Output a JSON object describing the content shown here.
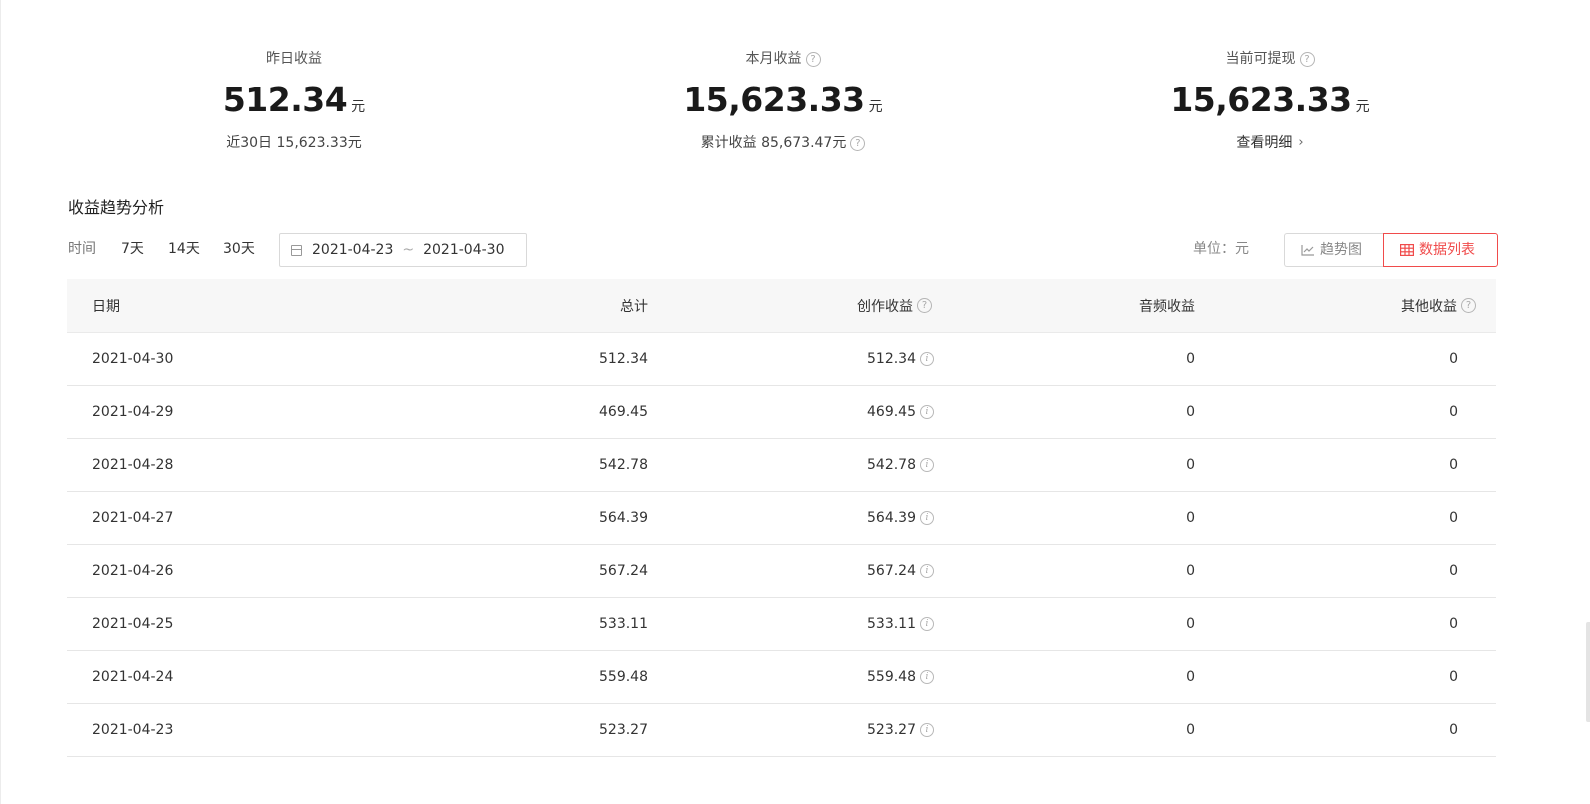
{
  "summary": {
    "yesterday": {
      "label": "昨日收益",
      "value": "512.34",
      "unit": "元",
      "sub": "近30日 15,623.33元"
    },
    "month": {
      "label": "本月收益",
      "value": "15,623.33",
      "unit": "元",
      "sub": "累计收益 85,673.47元"
    },
    "withdrawable": {
      "label": "当前可提现",
      "value": "15,623.33",
      "unit": "元",
      "link": "查看明细"
    }
  },
  "section": {
    "title": "收益趋势分析"
  },
  "toolbar": {
    "time_label": "时间",
    "ranges": [
      "7天",
      "14天",
      "30天"
    ],
    "date_start": "2021-04-23",
    "date_sep": "~",
    "date_end": "2021-04-30",
    "unit_label": "单位：元",
    "view_chart": "趋势图",
    "view_table": "数据列表",
    "accent_color": "#f04b4b"
  },
  "table": {
    "headers": {
      "date": "日期",
      "total": "总计",
      "creation": "创作收益",
      "audio": "音频收益",
      "other": "其他收益"
    },
    "rows": [
      {
        "date": "2021-04-30",
        "total": "512.34",
        "creation": "512.34",
        "audio": "0",
        "other": "0"
      },
      {
        "date": "2021-04-29",
        "total": "469.45",
        "creation": "469.45",
        "audio": "0",
        "other": "0"
      },
      {
        "date": "2021-04-28",
        "total": "542.78",
        "creation": "542.78",
        "audio": "0",
        "other": "0"
      },
      {
        "date": "2021-04-27",
        "total": "564.39",
        "creation": "564.39",
        "audio": "0",
        "other": "0"
      },
      {
        "date": "2021-04-26",
        "total": "567.24",
        "creation": "567.24",
        "audio": "0",
        "other": "0"
      },
      {
        "date": "2021-04-25",
        "total": "533.11",
        "creation": "533.11",
        "audio": "0",
        "other": "0"
      },
      {
        "date": "2021-04-24",
        "total": "559.48",
        "creation": "559.48",
        "audio": "0",
        "other": "0"
      },
      {
        "date": "2021-04-23",
        "total": "523.27",
        "creation": "523.27",
        "audio": "0",
        "other": "0"
      }
    ]
  }
}
